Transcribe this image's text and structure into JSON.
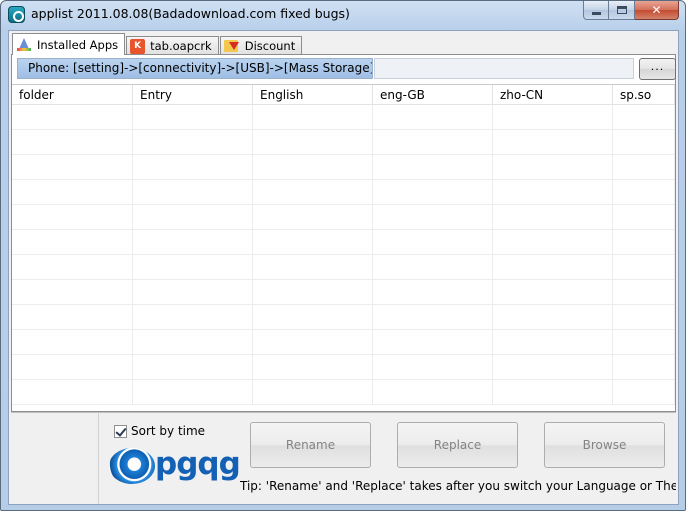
{
  "window": {
    "title": "applist 2011.08.08(Badadownload.com fixed bugs)"
  },
  "tabs": [
    {
      "label": "Installed Apps",
      "icon": "installed-apps-icon",
      "active": true
    },
    {
      "label": "tab.oapcrk",
      "icon": "oap-icon",
      "icon_glyph": "K",
      "active": false
    },
    {
      "label": "Discount",
      "icon": "discount-icon",
      "active": false
    }
  ],
  "path": {
    "text": "Phone: [setting]->[connectivity]->[USB]->[Mass Storage]",
    "browse_label": "..."
  },
  "grid": {
    "columns": [
      "folder",
      "Entry",
      "English",
      "eng-GB",
      "zho-CN",
      "sp.so"
    ],
    "rows": []
  },
  "bottom": {
    "sort_label": "Sort by time",
    "sort_checked": true,
    "logo_text": "pgqg",
    "buttons": {
      "rename": "Rename",
      "replace": "Replace",
      "browse": "Browse"
    },
    "tip": "Tip: 'Rename' and 'Replace' takes after you switch your Language or Theme to"
  }
}
